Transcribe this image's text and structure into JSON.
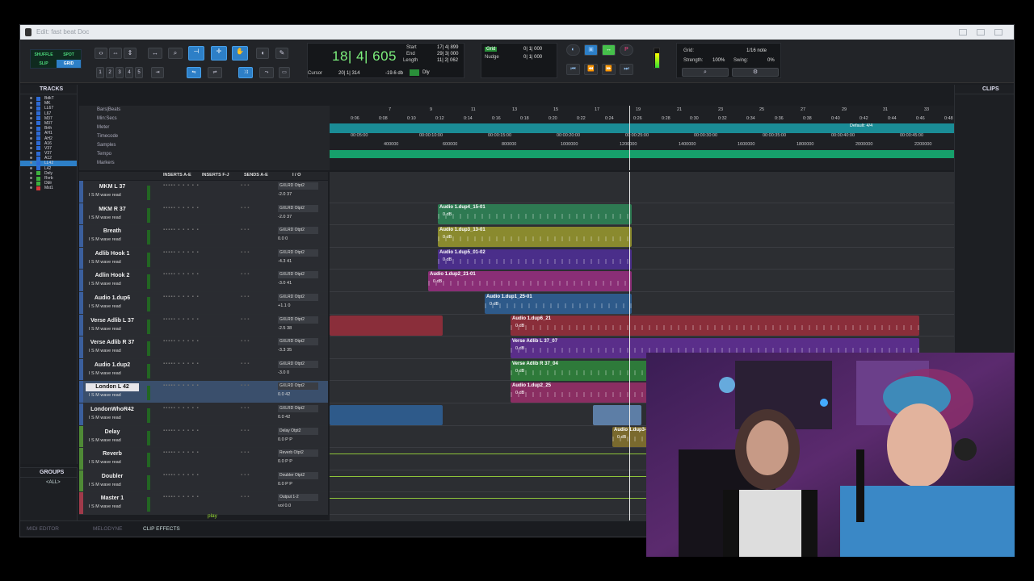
{
  "window": {
    "title": "Edit: fast beat Doc"
  },
  "edit_modes": [
    "SHUFFLE",
    "SPOT",
    "SLIP",
    "GRID"
  ],
  "zoom_presets": [
    "1",
    "2",
    "3",
    "4",
    "5"
  ],
  "counter": {
    "main": "18| 4| 605",
    "cursor_label": "Cursor",
    "cursor_value": "20| 1| 314",
    "cursor_db": "-19.6 db",
    "start_label": "Start",
    "end_label": "End",
    "length_label": "Length",
    "start_value": "17| 4| 899",
    "end_value": "29| 3| 000",
    "length_value": "11| 2| 062",
    "dly": "Dly"
  },
  "grid": {
    "grid_label": "Grid",
    "nudge_label": "Nudge",
    "grid_value": "0| 1| 000",
    "nudge_value": "0| 1| 000"
  },
  "settings": {
    "grid_label": "Grid:",
    "grid_value": "1/16 note",
    "strength_label": "Strength:",
    "strength_value": "100%",
    "swing_label": "Swing:",
    "swing_value": "0%"
  },
  "tracks_panel": {
    "title": "TRACKS",
    "items": [
      "BdkT",
      "MK",
      "LL67",
      "L67",
      "M37",
      "M37",
      "Brth",
      "AH1",
      "AH2",
      "A16",
      "V37",
      "V37",
      "A12",
      "LL42",
      "L42",
      "Dely",
      "Rvrb",
      "Dblr",
      "Mst1"
    ]
  },
  "groups_panel": {
    "title": "GROUPS",
    "all": "<ALL>"
  },
  "clips_panel": {
    "title": "CLIPS"
  },
  "rulers": {
    "labels": [
      "Bars|Beats",
      "Min:Secs",
      "Meter",
      "Timecode",
      "Samples",
      "Tempo",
      "Markers"
    ],
    "bars": [
      "7",
      "9",
      "11",
      "13",
      "15",
      "17",
      "19",
      "21",
      "23",
      "25",
      "27",
      "29",
      "31",
      "33"
    ],
    "minsecs": [
      "0:06",
      "0:08",
      "0:10",
      "0:12",
      "0:14",
      "0:16",
      "0:18",
      "0:20",
      "0:22",
      "0:24",
      "0:26",
      "0:28",
      "0:30",
      "0:32",
      "0:34",
      "0:36",
      "0:38",
      "0:40",
      "0:42",
      "0:44",
      "0:46",
      "0:48"
    ],
    "meter": "Default: 4/4",
    "timecode": [
      "00:05:00",
      "00:00:10:00",
      "00:00:15:00",
      "00:00:20:00",
      "00:00:25:00",
      "00:00:30:00",
      "00:00:35:00",
      "00:00:40:00",
      "00:00:45:00"
    ],
    "samples": [
      "400000",
      "600000",
      "800000",
      "1000000",
      "1200000",
      "1400000",
      "1600000",
      "1800000",
      "2000000",
      "2200000"
    ]
  },
  "mix_headers": [
    "INSERTS A-E",
    "INSERTS F-J",
    "SENDS A-E",
    "I / O"
  ],
  "tracks": [
    {
      "name": "MKM L 37",
      "io": "GXLRD Otpt2",
      "vol": "-2.0  37"
    },
    {
      "name": "MKM R 37",
      "io": "GXLRD Otpt2",
      "vol": "-2.0  37"
    },
    {
      "name": "Breath",
      "io": "GXLRD Otpt2",
      "vol": "0.0  0"
    },
    {
      "name": "Adlib Hook 1",
      "io": "GXLRD Otpt2",
      "vol": "-4.3  41"
    },
    {
      "name": "Adlin Hook 2",
      "io": "GXLRD Otpt2",
      "vol": "-3.0  41"
    },
    {
      "name": "Audio 1.dup6",
      "io": "GXLRD Otpt2",
      "vol": "+1.1  0"
    },
    {
      "name": "Verse Adlib L 37",
      "io": "GXLRD Otpt2",
      "vol": "-2.5  38"
    },
    {
      "name": "Verse Adlib R 37",
      "io": "GXLRD Otpt2",
      "vol": "-3.3  35"
    },
    {
      "name": "Audio 1.dup2",
      "io": "GXLRD Otpt2",
      "vol": "-3.0  0"
    },
    {
      "name": "London L 42",
      "io": "GXLRD Otpt2",
      "vol": "0.0  42"
    },
    {
      "name": "LondonWhoR42",
      "io": "GXLRD Otpt2",
      "vol": "0.0  42"
    },
    {
      "name": "Delay",
      "io": "Delay  Otpt2",
      "vol": "0.0  P  P"
    },
    {
      "name": "Reverb",
      "io": "Reverb Otpt2",
      "vol": "0.0  P  P"
    },
    {
      "name": "Doubler",
      "io": "Doubler Otpt2",
      "vol": "0.0  P  P"
    },
    {
      "name": "Master 1",
      "io": "Output 1-2",
      "vol": "vol  0.0"
    }
  ],
  "track_ctrl_label": "I S M  wave  read",
  "clips": [
    {
      "title": "Audio 1.dup4_15-01",
      "gain": "0 dB"
    },
    {
      "title": "Audio 1.dup3_13-01",
      "gain": "0 dB"
    },
    {
      "title": "Audio 1.dup5_01-02",
      "gain": "0 dB"
    },
    {
      "title": "Audio 1.dup2_21-01",
      "gain": "0 dB"
    },
    {
      "title": "Audio 1.dup1_25-01",
      "gain": "0 dB"
    },
    {
      "title": "Audio 1.dup6_21",
      "gain": "0 dB"
    },
    {
      "title": "Verse Adlib L 37_07",
      "gain": "0 dB"
    },
    {
      "title": "Verse Adlib R 37_04",
      "gain": "0 dB"
    },
    {
      "title": "Audio 1.dup2_25",
      "gain": "0 dB"
    },
    {
      "title": "Audio 1.dup3-Gain",
      "gain": "0 dB"
    }
  ],
  "bottom_tabs": [
    "MIDI EDITOR",
    "MELODYNE",
    "CLIP EFFECTS"
  ],
  "play_label": "play",
  "colors": {
    "accent": "#2d7fc7",
    "counter_green": "#7df07d",
    "ruler_green": "#16a06b",
    "ruler_teal": "#1a8c96"
  }
}
